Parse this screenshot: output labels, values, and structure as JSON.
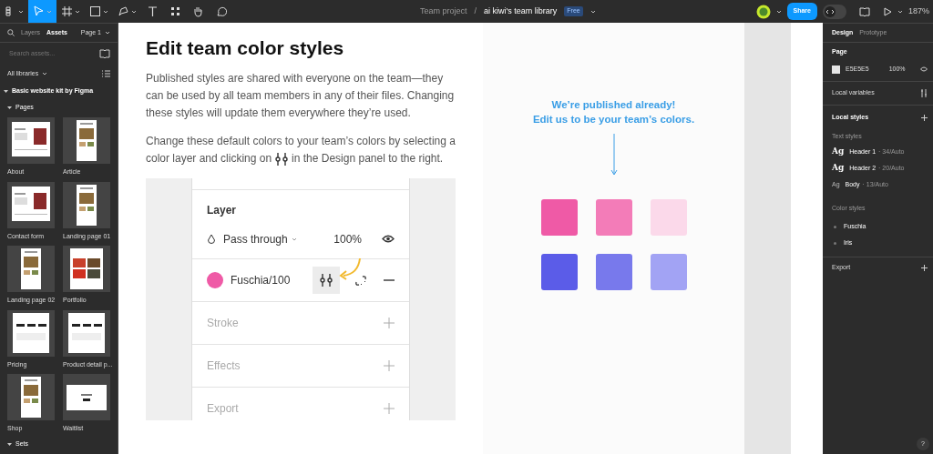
{
  "toolbar": {
    "tools": [
      {
        "kind": "menu",
        "selected": false
      },
      {
        "kind": "move",
        "selected": true
      },
      {
        "kind": "frame",
        "selected": false
      },
      {
        "kind": "shape",
        "selected": false
      },
      {
        "kind": "pen",
        "selected": false
      },
      {
        "kind": "text",
        "selected": false
      },
      {
        "kind": "resources",
        "selected": false
      },
      {
        "kind": "hand",
        "selected": false
      },
      {
        "kind": "comment",
        "selected": false
      }
    ],
    "breadcrumb": {
      "project": "Team project",
      "separator": "/",
      "file": "ai kiwi's team library",
      "badge": "Free"
    },
    "share_label": "Share",
    "zoom": "187%"
  },
  "left_panel": {
    "tabs": [
      {
        "label": "Layers",
        "selected": false
      },
      {
        "label": "Assets",
        "selected": true
      }
    ],
    "page": "Page 1",
    "search": {
      "placeholder": "Search assets..."
    },
    "library_filter": "All libraries",
    "library": {
      "title": "Basic website kit by Figma",
      "expanded": true
    },
    "pages_group": {
      "title": "Pages",
      "expanded": true
    },
    "pages": [
      {
        "name": "About",
        "kind": "split"
      },
      {
        "name": "Article",
        "kind": "tall"
      },
      {
        "name": "Contact form",
        "kind": "split"
      },
      {
        "name": "Landing page 01",
        "kind": "tall"
      },
      {
        "name": "Landing page 02",
        "kind": "tall"
      },
      {
        "name": "Portfolio",
        "kind": "grid"
      },
      {
        "name": "Pricing",
        "kind": "columns"
      },
      {
        "name": "Product detail p...",
        "kind": "columns"
      },
      {
        "name": "Shop",
        "kind": "tall"
      },
      {
        "name": "Waitlist",
        "kind": "wide"
      }
    ],
    "sets": {
      "title": "Sets",
      "expanded": true
    }
  },
  "document": {
    "heading": "Edit team color styles",
    "paragraph": "Published styles are shared with everyone on the team—they can be used by all team members in any of their files. Changing these styles will update them everywhere they’re used.",
    "instruction": {
      "line_1": "Change these default colors to your team’s colors by selecting a",
      "before": "color layer and clicking on",
      "after": "in the Design panel to the right."
    },
    "panel_preview": {
      "layer_title": "Layer",
      "blend": "Pass through",
      "opacity": "100%",
      "fill": {
        "name": "Fuschia/100",
        "color": "#ef5aa6"
      },
      "sections": [
        "Stroke",
        "Effects",
        "Export"
      ]
    },
    "callout": [
      "We’re published already!",
      "Edit us to be your team’s colors."
    ],
    "swatches": [
      {
        "color": "#ef5aa6"
      },
      {
        "color": "#f37cb8"
      },
      {
        "color": "#fbd9ea"
      },
      {
        "color": "#5b5ce8"
      },
      {
        "color": "#7879ec"
      },
      {
        "color": "#a2a3f4"
      }
    ]
  },
  "right_panel": {
    "tabs": [
      {
        "label": "Design",
        "selected": true
      },
      {
        "label": "Prototype",
        "selected": false
      }
    ],
    "page_section": {
      "title": "Page",
      "color_value": "E5E5E5",
      "opacity": "100%"
    },
    "local_variables": "Local variables",
    "local_styles": "Local styles",
    "text_styles": {
      "title": "Text styles",
      "items": [
        {
          "sample": "Ag",
          "kind": "large",
          "name": "Header 1",
          "detail": "· 34/Auto"
        },
        {
          "sample": "Ag",
          "kind": "large",
          "name": "Header 2",
          "detail": "· 20/Auto"
        },
        {
          "sample": "Ag",
          "kind": "small",
          "name": "Body",
          "detail": "· 13/Auto"
        }
      ]
    },
    "color_styles": {
      "title": "Color styles",
      "items": [
        "Fuschia",
        "Iris"
      ]
    },
    "export": "Export",
    "help": "?"
  }
}
